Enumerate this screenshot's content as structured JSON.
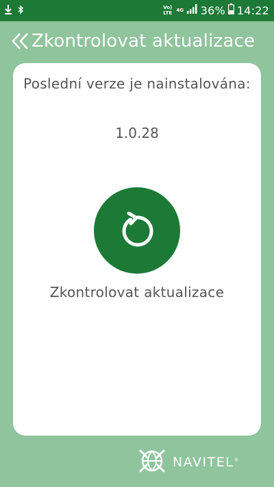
{
  "status_bar": {
    "notification_icons": [
      "download-icon",
      "bluetooth-icon"
    ],
    "volte_label": "Vo) LTE",
    "network_label": "4G",
    "battery_percent": "36%",
    "time": "14:22"
  },
  "header": {
    "back_icon": "double-chevron-left-icon",
    "title": "Zkontrolovat aktualizace"
  },
  "card": {
    "installed_label": "Poslední verze je nainstalována:",
    "version": "1.0.28",
    "check_button_icon": "refresh-icon",
    "check_label": "Zkontrolovat aktualizace"
  },
  "brand": {
    "logo_icon": "navitel-globe-icon",
    "name": "NAVITEL",
    "registered_mark": "®"
  },
  "colors": {
    "background": "#8fc49c",
    "status_bar": "#1c7a36",
    "accent": "#1c7a36",
    "card": "#ffffff",
    "text": "#555555"
  }
}
